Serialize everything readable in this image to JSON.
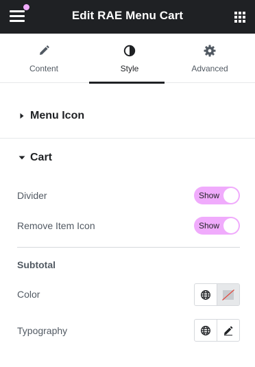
{
  "header": {
    "title": "Edit RAE Menu Cart",
    "notification_dot_color": "#f0abfc",
    "menu_icon": "hamburger-icon",
    "apps_icon": "grid-icon"
  },
  "tabs": [
    {
      "label": "Content",
      "icon": "pencil-icon",
      "active": false
    },
    {
      "label": "Style",
      "icon": "half-circle-icon",
      "active": true
    },
    {
      "label": "Advanced",
      "icon": "gear-icon",
      "active": false
    }
  ],
  "sections": {
    "menu_icon": {
      "title": "Menu Icon",
      "expanded": false
    },
    "cart": {
      "title": "Cart",
      "expanded": true
    }
  },
  "controls": {
    "divider": {
      "label": "Divider",
      "toggle_text": "Show"
    },
    "remove_item_icon": {
      "label": "Remove Item Icon",
      "toggle_text": "Show"
    },
    "subtotal_heading": "Subtotal",
    "color": {
      "label": "Color"
    },
    "typography": {
      "label": "Typography"
    }
  },
  "colors": {
    "header_bg": "#1f2124",
    "accent_toggle": "#f0abfc"
  }
}
